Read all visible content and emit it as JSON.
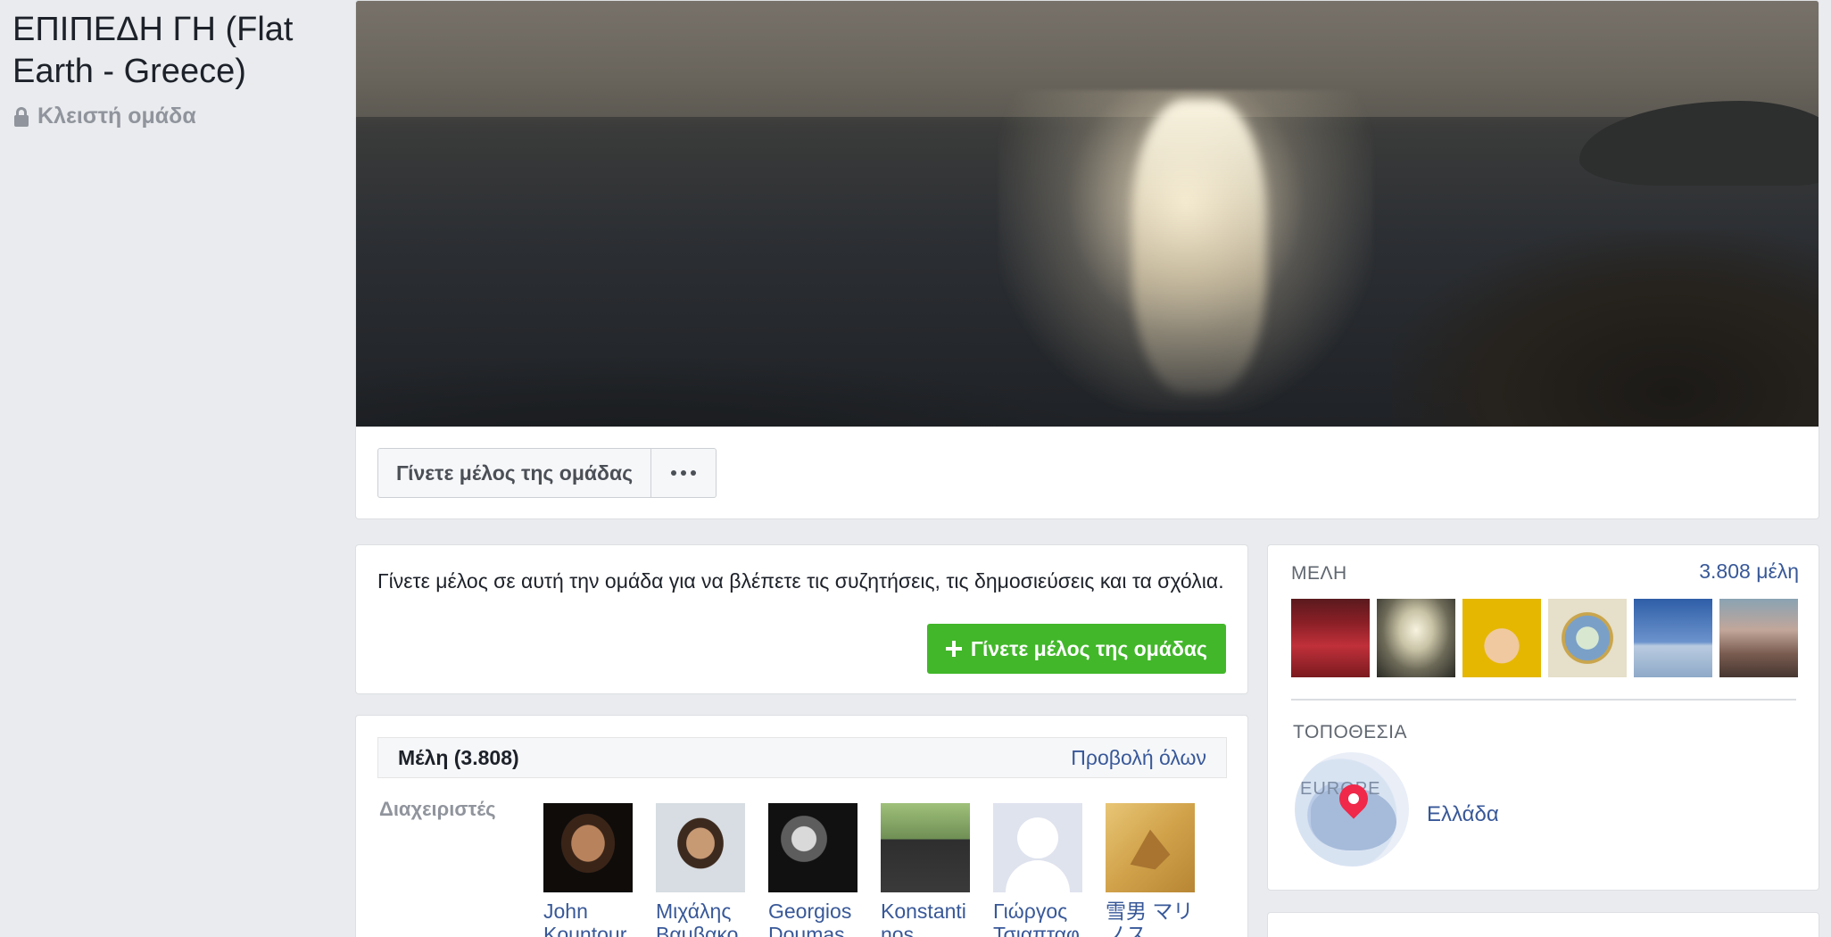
{
  "group": {
    "title": "ΕΠΙΠΕΔΗ ΓΗ (Flat Earth - Greece)",
    "privacy": "Κλειστή ομάδα"
  },
  "cover": {
    "join_button": "Γίνετε μέλος της ομάδας",
    "more_icon": "more-dots-icon"
  },
  "join_prompt": {
    "text": "Γίνετε μέλος σε αυτή την ομάδα για να βλέπετε τις συζητήσεις, τις δημοσιεύσεις και τα σχόλια.",
    "button": "Γίνετε μέλος της ομάδας"
  },
  "members": {
    "title": "Μέλη (3.808)",
    "see_all": "Προβολή όλων",
    "admins_label": "Διαχειριστές",
    "admins": [
      {
        "name": "John Kountour"
      },
      {
        "name": "Μιχάλης Βαμβακού"
      },
      {
        "name": "Georgios Doumas"
      },
      {
        "name": "Konstantinos"
      },
      {
        "name": "Γιώργος Τσιαπταφ"
      },
      {
        "name": "雪男 マリノス"
      }
    ]
  },
  "sidebar": {
    "members_label": "ΜΕΛΗ",
    "members_count": "3.808 μέλη",
    "location_label": "ΤΟΠΟΘΕΣΙΑ",
    "map_text": "EUROPE",
    "location_name": "Ελλάδα"
  },
  "colors": {
    "background": "#e9ebee",
    "link": "#385898",
    "green": "#42b72a",
    "pin": "#f02849"
  }
}
